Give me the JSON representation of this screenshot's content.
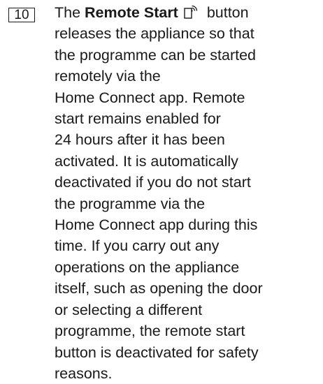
{
  "item": {
    "number": "10",
    "lines": {
      "l1_pre": "The ",
      "l1_bold": "Remote Start",
      "l1_post": " button",
      "l2": "releases the appliance so that",
      "l3": "the programme can be started",
      "l4": "remotely via the",
      "l5": "Home Connect app. Remote",
      "l6": "start remains enabled for",
      "l7": "24 hours after it has been",
      "l8": "activated. It is automatically",
      "l9": "deactivated if you do not start",
      "l10": "the programme via the",
      "l11": "Home Connect app during this",
      "l12": "time. If you carry out any",
      "l13": "operations on the appliance",
      "l14": "itself, such as opening the door",
      "l15": "or selecting a different",
      "l16": "programme, the remote start",
      "l17": "button is deactivated for safety",
      "l18": "reasons."
    },
    "icon": "remote-start-icon"
  }
}
